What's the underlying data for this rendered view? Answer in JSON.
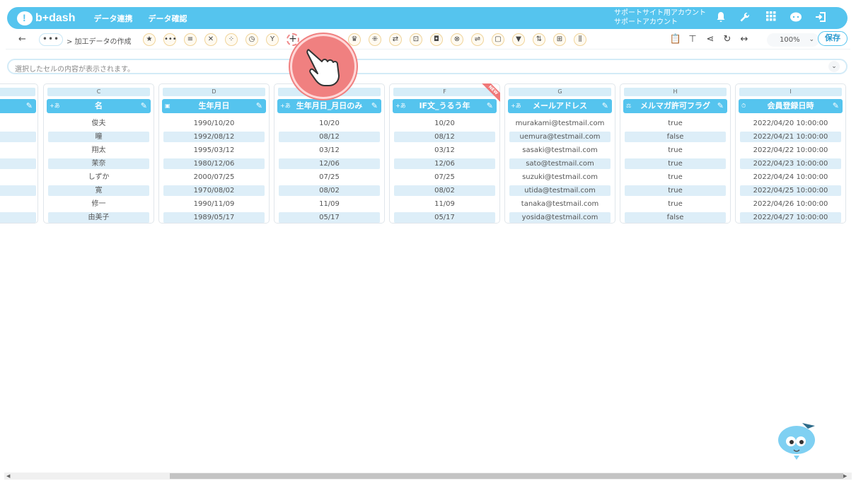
{
  "header": {
    "logo_text": "b+dash",
    "nav": [
      "データ連携",
      "データ確認"
    ],
    "account_line1": "サポートサイト用アカウント",
    "account_line2": "サポートアカウント",
    "icons": [
      "bell-icon",
      "wrench-icon",
      "grid-apps-icon",
      "chat-bot-icon",
      "logout-icon"
    ]
  },
  "toolbar": {
    "back_label": "←",
    "more_label": "•••",
    "breadcrumb": "> 加工データの作成",
    "zoom": "100%",
    "save_label": "保存"
  },
  "cellbar": {
    "placeholder": "選択したセルの内容が表示されます。"
  },
  "columns": [
    {
      "letter": "C",
      "title": "名",
      "type_icon": "+あ",
      "values": [
        "俊夫",
        "瞳",
        "翔太",
        "茉奈",
        "しずか",
        "寛",
        "修一",
        "由美子"
      ]
    },
    {
      "letter": "D",
      "title": "生年月日",
      "type_icon": "▣",
      "values": [
        "1990/10/20",
        "1992/08/12",
        "1995/03/12",
        "1980/12/06",
        "2000/07/25",
        "1970/08/02",
        "1990/11/09",
        "1989/05/17"
      ]
    },
    {
      "letter": "",
      "title": "生年月日_月日のみ",
      "type_icon": "+あ",
      "values": [
        "10/20",
        "08/12",
        "03/12",
        "12/06",
        "07/25",
        "08/02",
        "11/09",
        "05/17"
      ]
    },
    {
      "letter": "F",
      "title": "IF文_うるう年",
      "type_icon": "+あ",
      "badge": "NEW",
      "values": [
        "10/20",
        "08/12",
        "03/12",
        "12/06",
        "07/25",
        "08/02",
        "11/09",
        "05/17"
      ]
    },
    {
      "letter": "G",
      "title": "メールアドレス",
      "type_icon": "+あ",
      "values": [
        "murakami@testmail.com",
        "uemura@testmail.com",
        "sasaki@testmail.com",
        "sato@testmail.com",
        "suzuki@testmail.com",
        "utida@testmail.com",
        "tanaka@testmail.com",
        "yosida@testmail.com"
      ]
    },
    {
      "letter": "H",
      "title": "メルマガ許可フラグ",
      "type_icon": "⚖",
      "values": [
        "true",
        "false",
        "true",
        "true",
        "true",
        "true",
        "true",
        "false"
      ]
    },
    {
      "letter": "I",
      "title": "会員登録日時",
      "type_icon": "⏱",
      "values": [
        "2022/04/20 10:00:00",
        "2022/04/21 10:00:00",
        "2022/04/22 10:00:00",
        "2022/04/23 10:00:00",
        "2022/04/24 10:00:00",
        "2022/04/25 10:00:00",
        "2022/04/26 10:00:00",
        "2022/04/27 10:00:00"
      ]
    }
  ],
  "colors": {
    "brand": "#55c4ee",
    "cell_alt": "#ddeef8",
    "cursor": "#f08080"
  }
}
